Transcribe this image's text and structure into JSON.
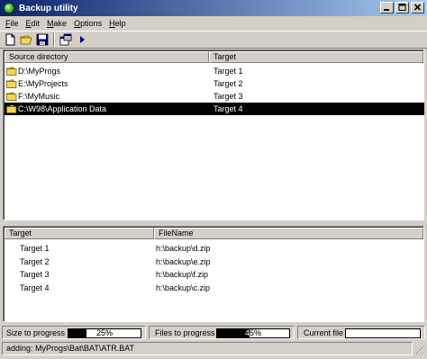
{
  "window": {
    "title": "Backup utility"
  },
  "menu": [
    {
      "label": "File",
      "u": "F",
      "rest": "ile"
    },
    {
      "label": "Edit",
      "u": "E",
      "rest": "dit"
    },
    {
      "label": "Make",
      "u": "M",
      "rest": "ake"
    },
    {
      "label": "Options",
      "u": "O",
      "rest": "ptions"
    },
    {
      "label": "Help",
      "u": "H",
      "rest": "elp"
    }
  ],
  "toolbar": {
    "icons": [
      "new-file-icon",
      "open-folder-icon",
      "save-icon",
      "properties-icon",
      "run-icon"
    ]
  },
  "sources": {
    "headers": {
      "source": "Source directory",
      "target": "Target"
    },
    "rows": [
      {
        "source": "D:\\MyProgs",
        "target": "Target 1",
        "selected": false
      },
      {
        "source": "E:\\MyProjects",
        "target": "Target 2",
        "selected": false
      },
      {
        "source": "F:\\MyMusic",
        "target": "Target 3",
        "selected": false
      },
      {
        "source": "C:\\W98\\Application Data",
        "target": "Target 4",
        "selected": true
      }
    ]
  },
  "targets": {
    "headers": {
      "target": "Target",
      "filename": "FileName"
    },
    "rows": [
      {
        "target": "Target 1",
        "filename": "h:\\backup\\d.zip"
      },
      {
        "target": "Target 2",
        "filename": "h:\\backup\\e.zip"
      },
      {
        "target": "Target 3",
        "filename": "h:\\backup\\f.zip"
      },
      {
        "target": "Target 4",
        "filename": "h:\\backup\\c.zip"
      }
    ]
  },
  "progress": {
    "size": {
      "label": "Size to progress",
      "value": 0.25,
      "text": "25%"
    },
    "files": {
      "label": "Files to progress",
      "value": 0.45,
      "text": "45%"
    },
    "current": {
      "label": "Current file",
      "value": 0.0,
      "text": "0%"
    }
  },
  "status": {
    "text": "adding: MyProgs\\Bat\\BAT\\ATR.BAT"
  },
  "colors": {
    "title_start": "#0a246a",
    "title_end": "#a6caf0",
    "selection": "#000000",
    "folder": "#f4d35e"
  }
}
